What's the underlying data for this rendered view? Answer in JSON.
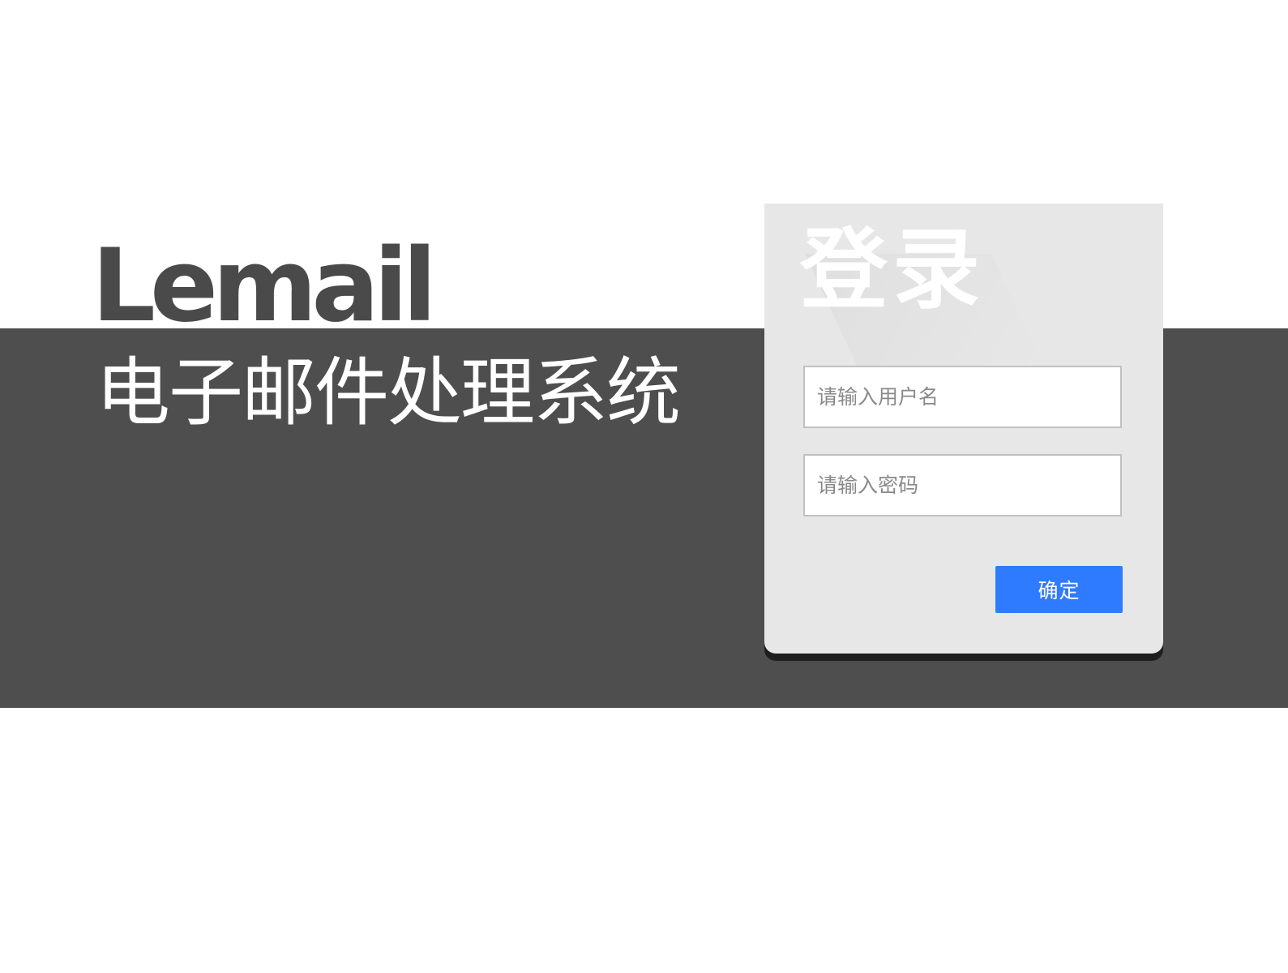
{
  "brand": {
    "name": "Lemail",
    "subtitle": "电子邮件处理系统"
  },
  "login": {
    "title": "登录",
    "username_placeholder": "请输入用户名",
    "password_placeholder": "请输入密码",
    "confirm_label": "确定"
  },
  "colors": {
    "band": "#4e4e4e",
    "card": "#e7e7e7",
    "button": "#2e7bff",
    "brand_text": "#4a4a4a"
  }
}
